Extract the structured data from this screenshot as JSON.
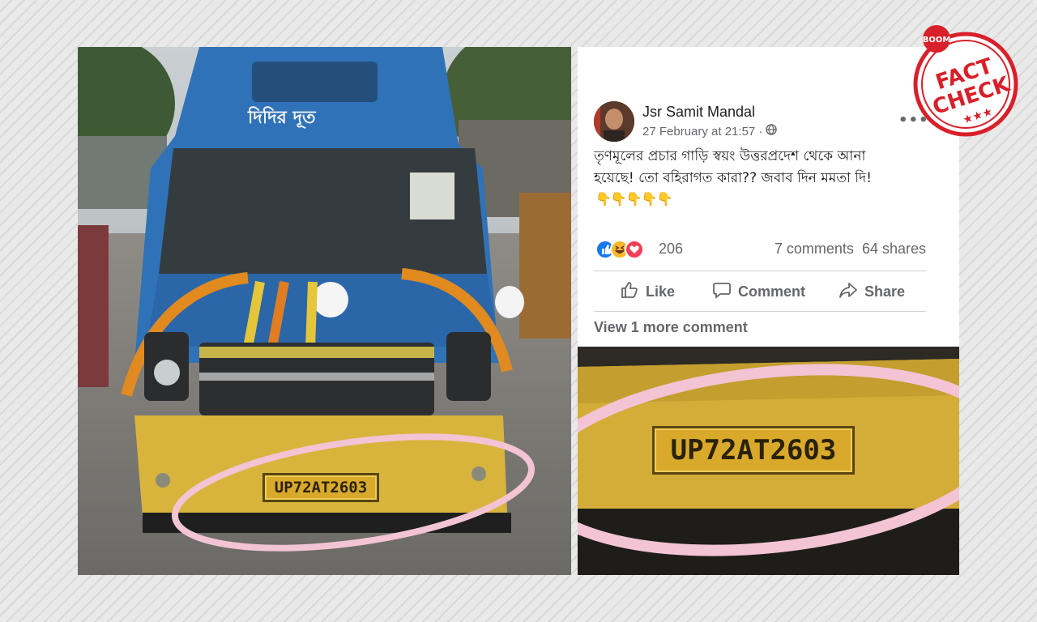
{
  "post": {
    "author": "Jsr Samit Mandal",
    "date": "27 February at 21:57 ·",
    "text_line1": "তৃণমূলের প্রচার গাড়ি স্বয়ং উত্তরপ্রদেশ থেকে আনা",
    "text_line2": "হয়েছে! তো বহিরাগত কারা?? জবাব দিন মমতা দি!",
    "emojis": "👇👇👇👇👇",
    "reactions_count": "206",
    "comments_label": "7 comments",
    "shares_label": "64 shares",
    "like_label": "Like",
    "comment_label": "Comment",
    "share_label": "Share",
    "view_more_label": "View 1 more comment"
  },
  "photo": {
    "van_banner": "দিদির দূত",
    "plate_number": "UP72AT2603"
  },
  "stamp": {
    "brand": "BOOM",
    "line1": "FACT",
    "line2": "CHECK"
  },
  "colors": {
    "van_blue": "#2f72b8",
    "van_yellow": "#d8b43c",
    "circle_pink": "#f2c4d4",
    "stamp_red": "#d8202a",
    "fb_text": "#1c1e21",
    "fb_secondary": "#65676b"
  }
}
